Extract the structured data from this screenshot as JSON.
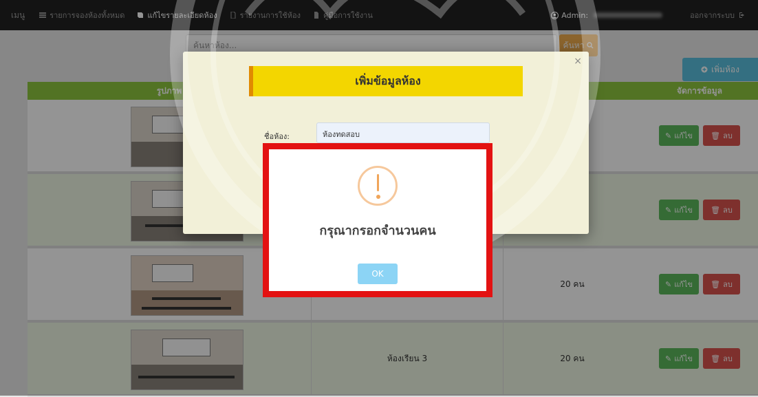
{
  "navbar": {
    "brand": "เมนู",
    "items": [
      {
        "label": "รายการจองห้องทั้งหมด",
        "icon": "list-icon",
        "active": false
      },
      {
        "label": "แก้ไขรายละเอียดห้อง",
        "icon": "book-icon",
        "active": true
      },
      {
        "label": "รายงานการใช้ห้อง",
        "icon": "file-icon",
        "active": false
      },
      {
        "label": "คู่มือการใช้งาน",
        "icon": "file-icon",
        "active": false
      }
    ],
    "admin_label": "Admin:",
    "logout_label": "ออกจากระบบ"
  },
  "search": {
    "placeholder": "ค้นหาห้อง...",
    "button_label": "ค้นหา"
  },
  "add_room_label": "เพิ่มห้อง",
  "table": {
    "headers": [
      "รูปภาพ",
      "",
      "",
      "จัดการข้อมูล"
    ],
    "rows": [
      {
        "name": "",
        "capacity": "",
        "edit": "แก้ไข",
        "delete": "ลบ"
      },
      {
        "name": "",
        "capacity": "",
        "edit": "แก้ไข",
        "delete": "ลบ"
      },
      {
        "name": "",
        "capacity": "20 คน",
        "edit": "แก้ไข",
        "delete": "ลบ"
      },
      {
        "name": "ห้องเรียน 3",
        "capacity": "20 คน",
        "edit": "แก้ไข",
        "delete": "ลบ"
      }
    ]
  },
  "modal": {
    "title": "เพิ่มข้อมูลห้อง",
    "close": "×",
    "field_label": "ชื่อห้อง:",
    "field_value": "ห้องทดสอบ"
  },
  "alert": {
    "title": "กรุณากรอกจำนวนคน",
    "ok_label": "OK",
    "icon": "warning-icon"
  },
  "colors": {
    "navbar": "#222222",
    "table_header": "#8dc63f",
    "edit": "#5cb85c",
    "delete": "#d9534f",
    "highlight_border": "#e31212",
    "modal_title_bg": "#f3d600"
  }
}
